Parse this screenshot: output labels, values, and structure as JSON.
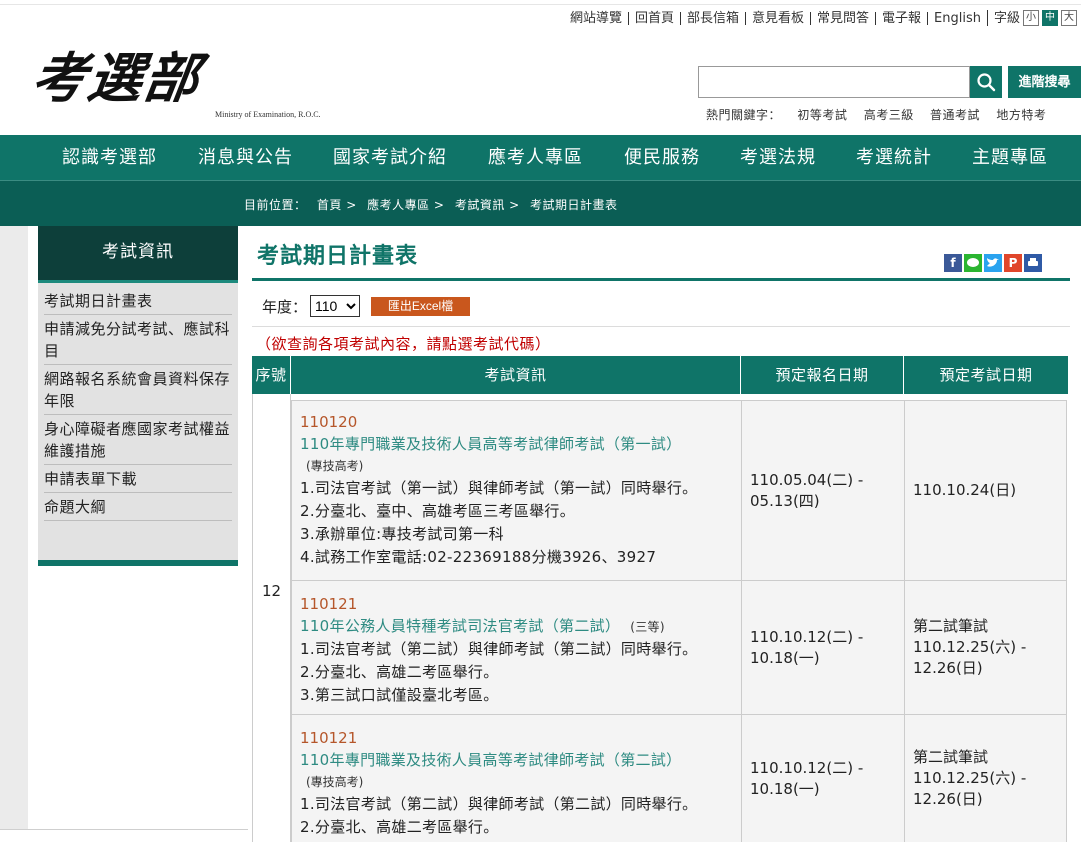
{
  "header": {
    "top_links": [
      "網站導覽",
      "回首頁",
      "部長信箱",
      "意見看板",
      "常見問答",
      "電子報",
      "English"
    ],
    "font_size_label": "字級",
    "font_sizes": [
      "小",
      "中",
      "大"
    ],
    "logo_text": "考選部",
    "logo_en": "Ministry of Examination, R.O.C.",
    "search_placeholder": "",
    "advanced_search": "進階搜尋",
    "hot_keywords_label": "熱門關鍵字：",
    "hot_keywords": [
      "初等考試",
      "高考三級",
      "普通考試",
      "地方特考"
    ]
  },
  "nav": [
    "認識考選部",
    "消息與公告",
    "國家考試介紹",
    "應考人專區",
    "便民服務",
    "考選法規",
    "考選統計",
    "主題專區"
  ],
  "breadcrumb": {
    "label": "目前位置：",
    "items": [
      "首頁",
      ">",
      "應考人專區",
      ">",
      "考試資訊",
      ">",
      "考試期日計畫表"
    ]
  },
  "sidebar": {
    "title": "考試資訊",
    "items": [
      "考試期日計畫表",
      "申請減免分試考試、應試科目",
      "網路報名系統會員資料保存年限",
      "身心障礙者應國家考試權益維護措施",
      "申請表單下載",
      "命題大綱"
    ]
  },
  "page": {
    "title": "考試期日計畫表",
    "year_label": "年度：",
    "year_value": "110",
    "excel_button": "匯出Excel檔",
    "notice": "（欲查詢各項考試內容，請點選考試代碼）"
  },
  "table": {
    "headers": [
      "序號",
      "考試資訊",
      "預定報名日期",
      "預定考試日期"
    ],
    "seq": "12",
    "rows": [
      {
        "code": "110120",
        "name": "110年專門職業及技術人員高等考試律師考試（第一試）",
        "category": "(專技高考)",
        "lines": [
          "1.司法官考試（第一試）與律師考試（第一試）同時舉行。",
          "2.分臺北、臺中、高雄考區三考區舉行。",
          "3.承辦單位:專技考試司第一科",
          "4.試務工作室電話:02-22369188分機3926、3927"
        ],
        "reg": [
          "110.05.04(二) -",
          "05.13(四)"
        ],
        "exam": [
          "110.10.24(日)"
        ]
      },
      {
        "code": "110121",
        "name": "110年公務人員特種考試司法官考試（第二試）",
        "category": "(三等)",
        "lines": [
          "1.司法官考試（第二試）與律師考試（第二試）同時舉行。",
          "2.分臺北、高雄二考區舉行。",
          "3.第三試口試僅設臺北考區。"
        ],
        "reg": [
          "110.10.12(二) -",
          "10.18(一)"
        ],
        "exam": [
          "第二試筆試",
          "110.12.25(六) -",
          "12.26(日)"
        ]
      },
      {
        "code": "110121",
        "name": "110年專門職業及技術人員高等考試律師考試（第二試）",
        "category": "(專技高考)",
        "lines": [
          "1.司法官考試（第二試）與律師考試（第二試）同時舉行。",
          "2.分臺北、高雄二考區舉行。"
        ],
        "reg": [
          "110.10.12(二) -",
          "10.18(一)"
        ],
        "exam": [
          "第二試筆試",
          "110.12.25(六) -",
          "12.26(日)"
        ]
      }
    ]
  },
  "colors": {
    "primary": "#0f7468",
    "dark": "#0b5e55",
    "accent": "#c9571d",
    "code": "#b5562a",
    "notice": "#c00000"
  }
}
